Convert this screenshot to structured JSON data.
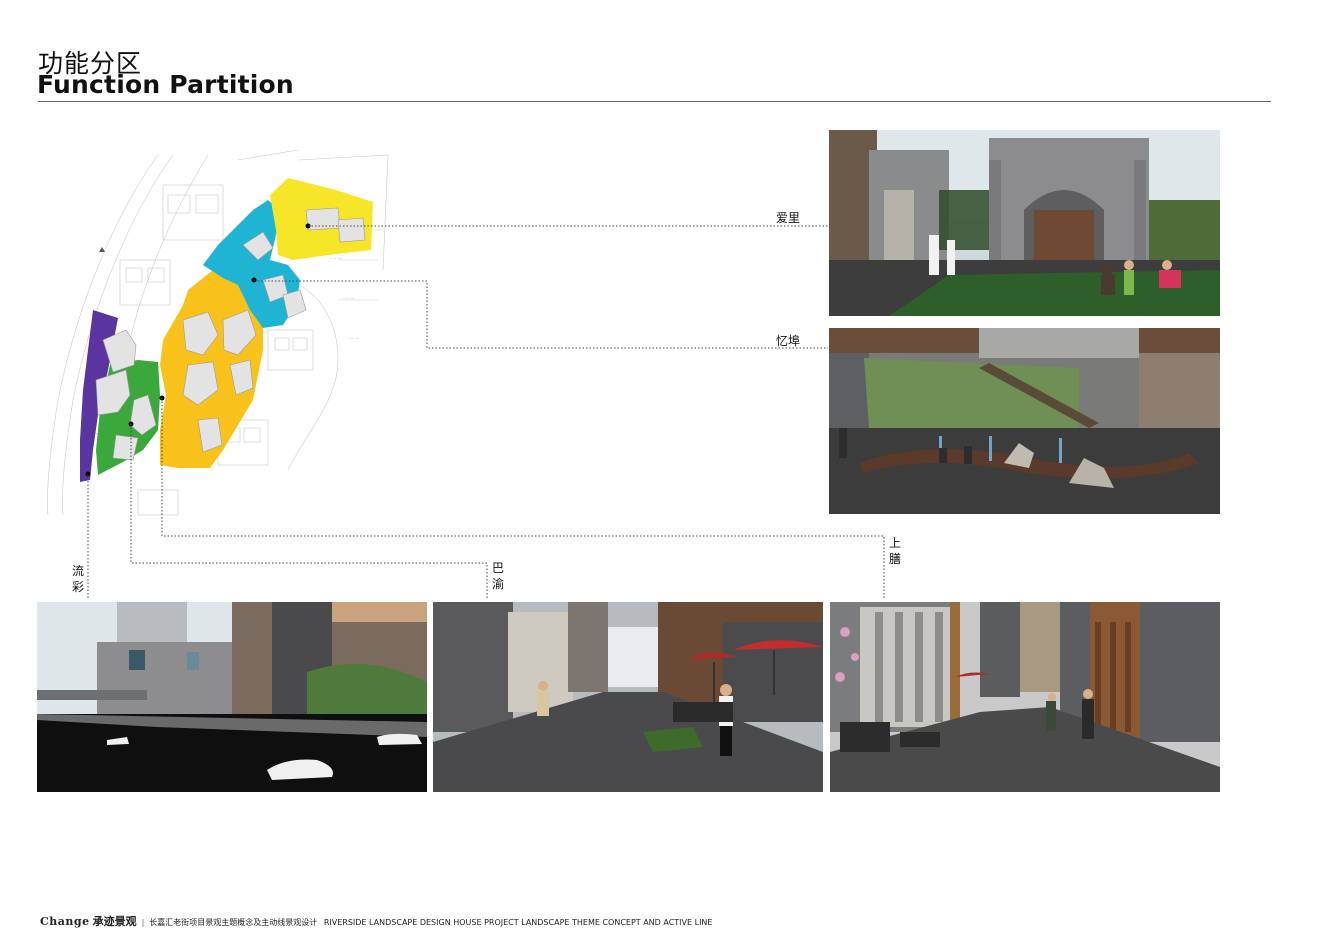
{
  "header": {
    "title_cn": "功能分区",
    "title_en": "Function Partition"
  },
  "zones": [
    {
      "key": "aili",
      "label": "爱里",
      "color": "#f7e627"
    },
    {
      "key": "yibu",
      "label": "忆埠",
      "color": "#1fb4d4"
    },
    {
      "key": "shangshan",
      "label": "上膳",
      "color": "#f8c21a"
    },
    {
      "key": "bayu",
      "label": "巴渝",
      "color": "#3aa83a"
    },
    {
      "key": "liucai",
      "label": "流彩",
      "color": "#5a35a0"
    }
  ],
  "footer": {
    "brand": "Change",
    "brand_cn": "承迹景观",
    "separator": "|",
    "project_cn": "长嘉汇老街项目景观主题概念及主动线景观设计",
    "project_en": "RIVERSIDE LANDSCAPE DESIGN HOUSE PROJECT LANDSCAPE THEME CONCEPT AND ACTIVE LINE"
  }
}
